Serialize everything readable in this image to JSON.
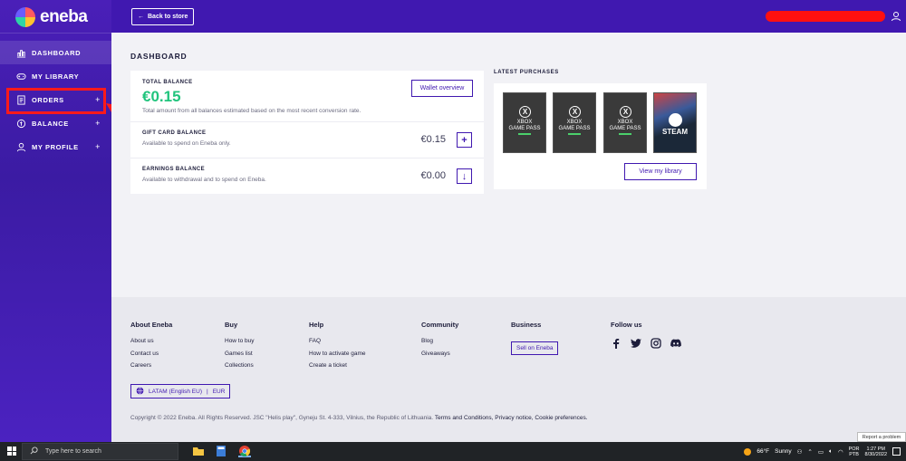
{
  "brand": {
    "name": "eneba"
  },
  "sidebar": {
    "items": [
      {
        "label": "DASHBOARD",
        "icon": "chart-icon",
        "has_plus": false,
        "active": true
      },
      {
        "label": "MY LIBRARY",
        "icon": "gamepad-icon",
        "has_plus": false,
        "active": false
      },
      {
        "label": "ORDERS",
        "icon": "receipt-icon",
        "has_plus": true,
        "active": false
      },
      {
        "label": "BALANCE",
        "icon": "wallet-icon",
        "has_plus": true,
        "active": false
      },
      {
        "label": "MY PROFILE",
        "icon": "user-icon",
        "has_plus": true,
        "active": false
      }
    ],
    "plus": "+"
  },
  "topbar": {
    "back_label": "Back to store"
  },
  "dashboard": {
    "title": "DASHBOARD",
    "total": {
      "label": "TOTAL BALANCE",
      "amount": "€0.15",
      "sub": "Total amount from all balances estimated based on the most recent conversion rate.",
      "button": "Wallet overview"
    },
    "gift": {
      "label": "GIFT CARD BALANCE",
      "sub": "Available to spend on Eneba only.",
      "amount": "€0.15",
      "button": "+"
    },
    "earnings": {
      "label": "EARNINGS BALANCE",
      "sub": "Available to withdrawal and to spend on Eneba.",
      "amount": "€0.00",
      "button": "↓"
    }
  },
  "latest": {
    "title": "LATEST PURCHASES",
    "items": [
      {
        "line1": "XBOX",
        "line2": "GAME PASS"
      },
      {
        "line1": "XBOX",
        "line2": "GAME PASS"
      },
      {
        "line1": "XBOX",
        "line2": "GAME PASS"
      }
    ],
    "steam": "STEAM",
    "button": "View my library"
  },
  "footer": {
    "about": {
      "title": "About Eneba",
      "links": [
        "About us",
        "Contact us",
        "Careers"
      ]
    },
    "buy": {
      "title": "Buy",
      "links": [
        "How to buy",
        "Games list",
        "Collections"
      ]
    },
    "help": {
      "title": "Help",
      "links": [
        "FAQ",
        "How to activate game",
        "Create a ticket"
      ]
    },
    "community": {
      "title": "Community",
      "links": [
        "Blog",
        "Giveaways"
      ]
    },
    "business": {
      "title": "Business",
      "button": "Sell on Eneba"
    },
    "follow": {
      "title": "Follow us"
    },
    "locale": {
      "region": "LATAM (English EU)",
      "sep": "|",
      "currency": "EUR"
    },
    "copyright": "Copyright © 2022 Eneba. All Rights Reserved. JSC \"Helis play\", Gyneju St. 4-333, Vilnius, the Republic of Lithuania.",
    "terms": "Terms and Conditions,",
    "privacy": "Privacy notice,",
    "cookies": "Cookie preferences."
  },
  "report_label": "Report a problem",
  "taskbar": {
    "search_placeholder": "Type here to search",
    "weather_temp": "66°F",
    "weather_desc": "Sunny",
    "lang1": "POR",
    "lang2": "PTB",
    "time": "1:27 PM",
    "date": "8/30/2022"
  },
  "colors": {
    "brand_purple": "#4018b0",
    "balance_green": "#21c47d",
    "annotation_red": "#ff1a1a"
  }
}
